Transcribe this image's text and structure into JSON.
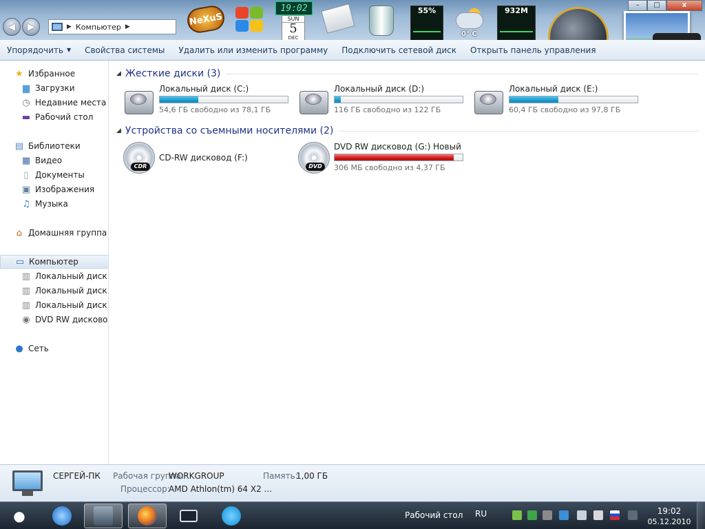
{
  "window": {
    "address": {
      "location": "Компьютер"
    },
    "controls": {
      "minimize": "–",
      "maximize": "□",
      "close": "x"
    }
  },
  "gadgets": {
    "nexus_label": "NeXuS",
    "clock_time": "19:02",
    "calendar": {
      "day_of_week": "SUN",
      "day": "5",
      "month": "DEC"
    },
    "cpu": "55%",
    "weather_temp": "0° C",
    "memory": "932M"
  },
  "toolbar": {
    "organize": "Упорядочить",
    "system_properties": "Свойства системы",
    "uninstall": "Удалить или изменить программу",
    "map_drive": "Подключить сетевой диск",
    "control_panel": "Открыть панель управления"
  },
  "sidebar": {
    "favorites": "Избранное",
    "downloads": "Загрузки",
    "recent": "Недавние места",
    "desktop": "Рабочий стол",
    "libraries": "Библиотеки",
    "video": "Видео",
    "documents": "Документы",
    "images": "Изображения",
    "music": "Музыка",
    "homegroup": "Домашняя группа",
    "computer": "Компьютер",
    "drive_c": "Локальный диск (C",
    "drive_d": "Локальный диск (D",
    "drive_e": "Локальный диск (E:",
    "drive_g": "DVD RW дисковод (",
    "network": "Сеть"
  },
  "groups": {
    "hard_drives": "Жесткие диски (3)",
    "removable": "Устройства со съемными носителями (2)"
  },
  "drives": [
    {
      "name": "Локальный диск (C:)",
      "free_text": "54,6 ГБ свободно из 78,1 ГБ",
      "used_fraction": 0.3
    },
    {
      "name": "Локальный диск (D:)",
      "free_text": "116 ГБ свободно из 122 ГБ",
      "used_fraction": 0.05
    },
    {
      "name": "Локальный диск (E:)",
      "free_text": "60,4 ГБ свободно из 97,8 ГБ",
      "used_fraction": 0.38
    },
    {
      "name": "CD-RW дисковод (F:)",
      "badge": "CDR"
    },
    {
      "name": "DVD RW дисковод (G:) Новый",
      "free_text": "306 МБ свободно из 4,37 ГБ",
      "used_fraction": 0.93,
      "badge": "DVD"
    }
  ],
  "details": {
    "computer_name": "СЕРГЕЙ-ПК",
    "workgroup_label": "Рабочая группа:",
    "workgroup_value": "WORKGROUP",
    "memory_label": "Память:",
    "memory_value": "1,00 ГБ",
    "cpu_label": "Процессор:",
    "cpu_value": "AMD Athlon(tm) 64 X2 ..."
  },
  "taskbar": {
    "desktop_label": "Рабочий стол",
    "language": "RU",
    "time": "19:02",
    "date": "05.12.2010"
  },
  "colors": {
    "accent": "#1e3287",
    "bar_blue": "#1a9ccf",
    "bar_red": "#d11616"
  }
}
